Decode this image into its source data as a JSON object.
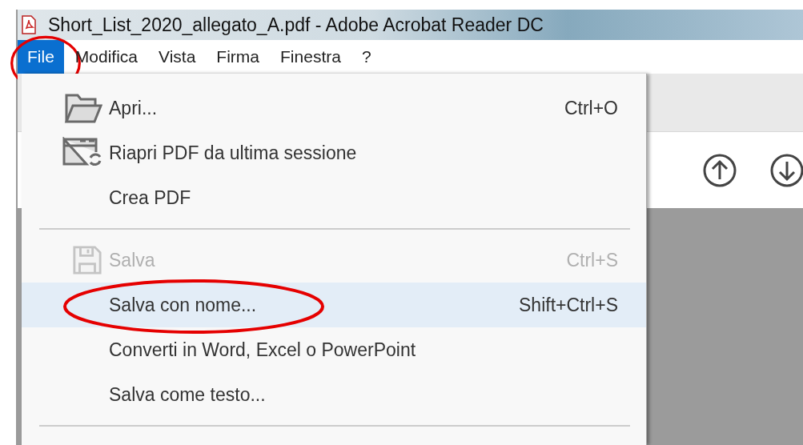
{
  "window": {
    "title": "Short_List_2020_allegato_A.pdf - Adobe Acrobat Reader DC"
  },
  "menubar": [
    {
      "label": "File",
      "selected": true,
      "annotated": true
    },
    {
      "label": "Modifica",
      "selected": false,
      "annotated": false
    },
    {
      "label": "Vista",
      "selected": false,
      "annotated": false
    },
    {
      "label": "Firma",
      "selected": false,
      "annotated": false
    },
    {
      "label": "Finestra",
      "selected": false,
      "annotated": false
    },
    {
      "label": "?",
      "selected": false,
      "annotated": false
    }
  ],
  "file_menu": [
    {
      "kind": "item",
      "label": "Apri...",
      "shortcut": "Ctrl+O",
      "disabled": false,
      "selected": false,
      "annotated": false
    },
    {
      "kind": "item",
      "label": "Riapri PDF da ultima sessione",
      "disabled": false,
      "selected": false,
      "annotated": false
    },
    {
      "kind": "item",
      "label": "Crea PDF",
      "disabled": false,
      "selected": false,
      "annotated": false
    },
    {
      "kind": "separator"
    },
    {
      "kind": "item",
      "label": "Salva",
      "shortcut": "Ctrl+S",
      "disabled": true,
      "selected": false,
      "annotated": false
    },
    {
      "kind": "item",
      "label": "Salva con nome...",
      "shortcut": "Shift+Ctrl+S",
      "disabled": false,
      "selected": true,
      "annotated": true
    },
    {
      "kind": "item",
      "label": "Converti in Word, Excel o PowerPoint",
      "disabled": false,
      "selected": false,
      "annotated": false
    },
    {
      "kind": "item",
      "label": "Salva come testo...",
      "disabled": false,
      "selected": false,
      "annotated": false
    },
    {
      "kind": "separator"
    }
  ]
}
